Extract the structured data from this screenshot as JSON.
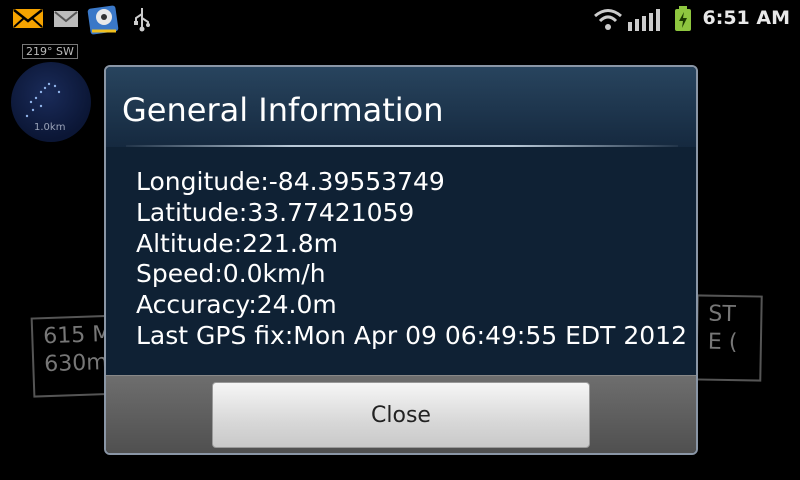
{
  "status_bar": {
    "time": "6:51 AM",
    "icons": [
      "mail-icon",
      "gmail-icon",
      "app-icon",
      "usb-icon",
      "wifi-icon",
      "signal-icon",
      "battery-charging-icon"
    ]
  },
  "background": {
    "compass_heading": "219° SW",
    "radar_range": "1.0km",
    "sign_left_lines": [
      "615 M",
      "630m"
    ],
    "sign_right_lines": [
      "ST",
      "E ("
    ]
  },
  "dialog": {
    "title": "General Information",
    "lines": [
      "Longitude:-84.39553749",
      "Latitude:33.77421059",
      "Altitude:221.8m",
      "Speed:0.0km/h",
      "Accuracy:24.0m",
      "Last GPS fix:Mon Apr 09 06:49:55 EDT 2012"
    ],
    "close_label": "Close"
  },
  "colors": {
    "dialog_bg": "#0f2033",
    "battery": "#8ec63f"
  }
}
